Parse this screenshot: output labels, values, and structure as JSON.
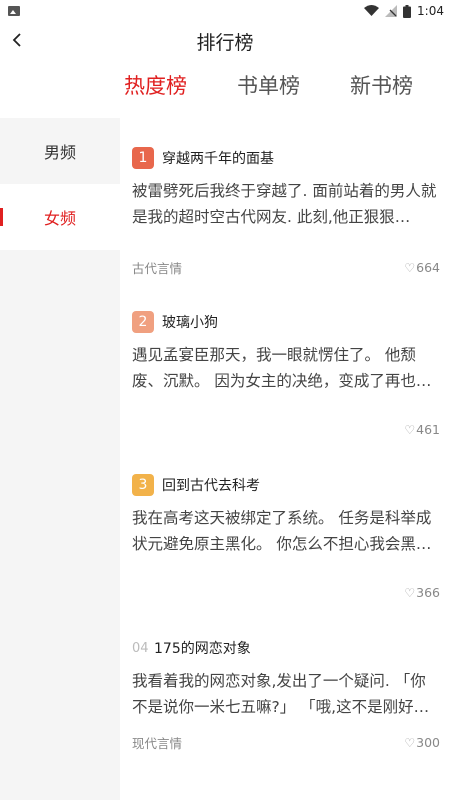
{
  "status_bar": {
    "time": "1:04"
  },
  "header": {
    "title": "排行榜"
  },
  "tabs": [
    {
      "label": "热度榜",
      "active": true
    },
    {
      "label": "书单榜",
      "active": false
    },
    {
      "label": "新书榜",
      "active": false
    }
  ],
  "sidebar": {
    "items": [
      {
        "label": "男频",
        "active": false
      },
      {
        "label": "女频",
        "active": true
      }
    ]
  },
  "colors": {
    "accent": "#e02020",
    "rank1": "#e8674c",
    "rank2": "#f0a080",
    "rank3": "#f2b24a"
  },
  "books": [
    {
      "rank": "1",
      "title": "穿越两千年的面基",
      "desc": "被雷劈死后我终于穿越了. 面前站着的男人就是我的超时空古代网友. 此刻,他正狠狠…",
      "tag": "古代言情",
      "likes": "664"
    },
    {
      "rank": "2",
      "title": "玻璃小狗",
      "desc": "遇见孟宴臣那天，我一眼就愣住了。 他颓废、沉默。 因为女主的决绝，变成了再也…",
      "tag": "",
      "likes": "461"
    },
    {
      "rank": "3",
      "title": "回到古代去科考",
      "desc": "我在高考这天被绑定了系统。 任务是科举成状元避免原主黑化。 你怎么不担心我会黑…",
      "tag": "",
      "likes": "366"
    },
    {
      "rank": "04",
      "title": "175的网恋对象",
      "desc": "我看着我的网恋对象,发出了一个疑问. 「你不是说你一米七五嘛?」 「哦,这不是刚好…",
      "tag": "现代言情",
      "likes": "300"
    }
  ]
}
